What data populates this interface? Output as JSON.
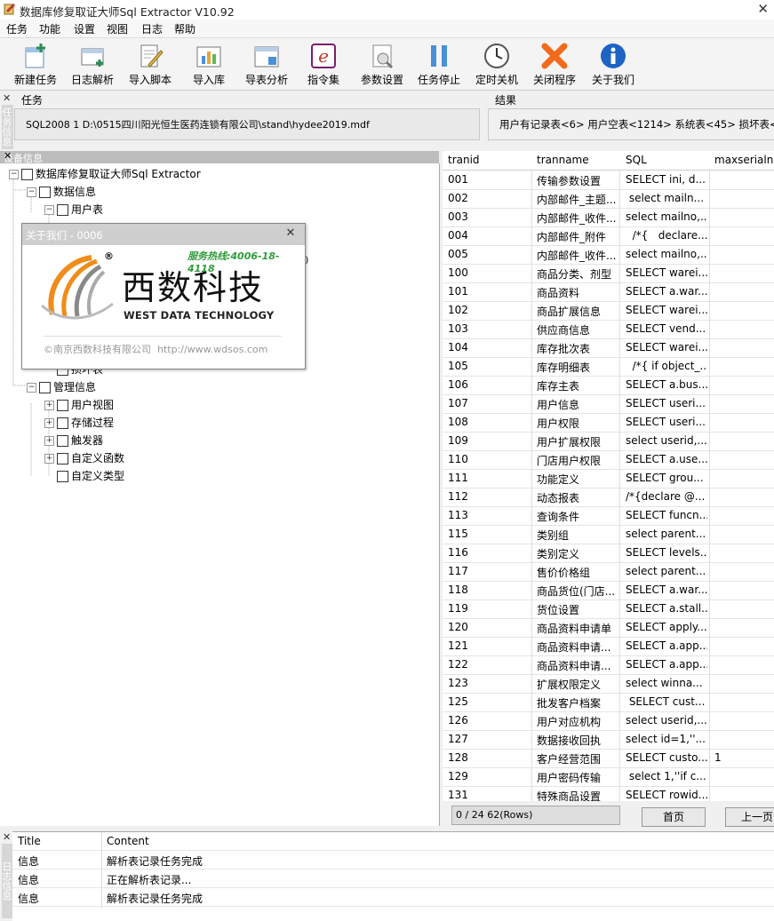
{
  "window": {
    "title": "数据库修复取证大师Sql Extractor V10.92"
  },
  "menu": [
    "任务",
    "功能",
    "设置",
    "视图",
    "日志",
    "帮助"
  ],
  "toolbar": [
    {
      "label": "新建任务",
      "icon": "new-task-icon"
    },
    {
      "label": "日志解析",
      "icon": "log-parse-icon"
    },
    {
      "label": "导入脚本",
      "icon": "import-script-icon"
    },
    {
      "label": "导入库",
      "icon": "import-db-icon"
    },
    {
      "label": "导表分析",
      "icon": "table-analysis-icon"
    },
    {
      "label": "指令集",
      "icon": "command-set-icon"
    },
    {
      "label": "参数设置",
      "icon": "settings-icon"
    },
    {
      "label": "任务停止",
      "icon": "pause-icon"
    },
    {
      "label": "定时关机",
      "icon": "clock-icon"
    },
    {
      "label": "关闭程序",
      "icon": "close-x-icon"
    },
    {
      "label": "关于我们",
      "icon": "info-icon"
    }
  ],
  "task_panel": {
    "side_tab": "任务信息",
    "label": "任务",
    "value": "SQL2008 1 D:\\0515四川阳光恒生医药连锁有限公司\\stand\\hydee2019.mdf"
  },
  "result_panel": {
    "label": "结果",
    "value": "用户有记录表<6> 用户空表<1214> 系统表<45> 损坏表<"
  },
  "device_panel": {
    "title": "设备信息",
    "tree": [
      {
        "label": "数据库修复取证大师Sql Extractor",
        "level": 0,
        "expander": "−"
      },
      {
        "label": "数据信息",
        "level": 1,
        "expander": "−"
      },
      {
        "label": "用户表",
        "level": 2,
        "expander": "−"
      },
      {
        "label": "损坏表",
        "level": 2,
        "expander": ""
      },
      {
        "label": "管理信息",
        "level": 1,
        "expander": "−"
      },
      {
        "label": "用户视图",
        "level": 2,
        "expander": "+"
      },
      {
        "label": "存储过程",
        "level": 2,
        "expander": "+"
      },
      {
        "label": "触发器",
        "level": 2,
        "expander": "+"
      },
      {
        "label": "自定义函数",
        "level": 2,
        "expander": "+"
      },
      {
        "label": "自定义类型",
        "level": 2,
        "expander": ""
      }
    ],
    "partial_text": "4)"
  },
  "about_dialog": {
    "title": "关于我们 - 0006",
    "hotline": "服务热线:4006-18-4118",
    "brand_cn": "西数科技",
    "brand_en": "WEST DATA TECHNOLOGY",
    "registered": "®",
    "footer": "©南京西数科技有限公司  http://www.wdsos.com"
  },
  "grid": {
    "columns": [
      "tranid",
      "tranname",
      "SQL",
      "maxserialno"
    ],
    "rows": [
      [
        "001",
        "传输参数设置",
        "SELECT ini, d...",
        ""
      ],
      [
        "002",
        "内部邮件_主题...",
        " select mailn...",
        ""
      ],
      [
        "003",
        "内部邮件_收件...",
        "select mailno,...",
        ""
      ],
      [
        "004",
        "内部邮件_附件",
        "  /*{   declare...",
        ""
      ],
      [
        "005",
        "内部邮件_收件...",
        "select mailno,...",
        ""
      ],
      [
        "100",
        "商品分类、剂型",
        "SELECT warei...",
        ""
      ],
      [
        "101",
        "商品资料",
        "SELECT a.war...",
        ""
      ],
      [
        "102",
        "商品扩展信息",
        "SELECT warei...",
        ""
      ],
      [
        "103",
        "供应商信息",
        "SELECT vend...",
        ""
      ],
      [
        "104",
        "库存批次表",
        "SELECT warei...",
        ""
      ],
      [
        "105",
        "库存明细表",
        "  /*{ if object_...",
        ""
      ],
      [
        "106",
        "库存主表",
        "SELECT a.bus...",
        ""
      ],
      [
        "107",
        "用户信息",
        "SELECT useri...",
        ""
      ],
      [
        "108",
        "用户权限",
        "SELECT useri...",
        ""
      ],
      [
        "109",
        "用户扩展权限",
        "select userid,...",
        ""
      ],
      [
        "110",
        "门店用户权限",
        "SELECT a.use...",
        ""
      ],
      [
        "111",
        "功能定义",
        "SELECT grou...",
        ""
      ],
      [
        "112",
        "动态报表",
        "/*{declare @...",
        ""
      ],
      [
        "113",
        "查询条件",
        "SELECT funcn...",
        ""
      ],
      [
        "115",
        "类别组",
        "select parent...",
        ""
      ],
      [
        "116",
        "类别定义",
        "SELECT levels...",
        ""
      ],
      [
        "117",
        "售价价格组",
        "select parent...",
        ""
      ],
      [
        "118",
        "商品货位(门店...",
        "SELECT a.war...",
        ""
      ],
      [
        "119",
        "货位设置",
        "SELECT a.stall...",
        ""
      ],
      [
        "120",
        "商品资料申请单",
        "SELECT apply...",
        ""
      ],
      [
        "121",
        "商品资料申请...",
        "SELECT a.app...",
        ""
      ],
      [
        "122",
        "商品资料申请...",
        "SELECT a.app...",
        ""
      ],
      [
        "123",
        "扩展权限定义",
        "select winna...",
        ""
      ],
      [
        "125",
        "批发客户档案",
        " SELECT cust...",
        ""
      ],
      [
        "126",
        "用户对应机构",
        "select userid,...",
        ""
      ],
      [
        "127",
        "数据接收回执",
        "select id=1,''...",
        ""
      ],
      [
        "128",
        "客户经营范围",
        "SELECT custo...",
        "1"
      ],
      [
        "129",
        "用户密码传输",
        " select 1,''if c...",
        ""
      ],
      [
        "131",
        "特殊商品设置",
        "SELECT rowid...",
        ""
      ]
    ]
  },
  "pager": {
    "info": "0 / 24  62(Rows)",
    "first": "首页",
    "prev": "上一页"
  },
  "log": {
    "side_tab": "日志信息",
    "columns": [
      "Title",
      "Content"
    ],
    "rows": [
      [
        "信息",
        "解析表记录任务完成"
      ],
      [
        "信息",
        "正在解析表记录..."
      ],
      [
        "信息",
        "解析表记录任务完成"
      ]
    ]
  }
}
